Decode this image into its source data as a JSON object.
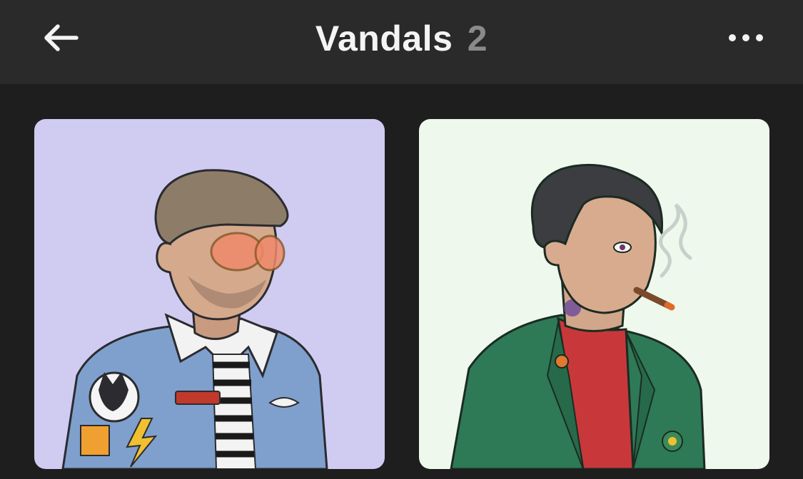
{
  "header": {
    "title": "Vandals",
    "count": "2",
    "back_icon": "arrow-left-icon",
    "more_icon": "more-horizontal-icon"
  },
  "grid": {
    "items": [
      {
        "name": "vandal-1",
        "background": "#d0cbf0",
        "description_icon": "avatar-denim-jacket-flat-cap"
      },
      {
        "name": "vandal-2",
        "background": "#eef8ec",
        "description_icon": "avatar-green-blazer-cigar"
      }
    ]
  },
  "colors": {
    "header_bg": "#2a2a2b",
    "page_bg": "#1e1e1f",
    "title": "#f4f4f4",
    "count": "#8a8a8c"
  }
}
